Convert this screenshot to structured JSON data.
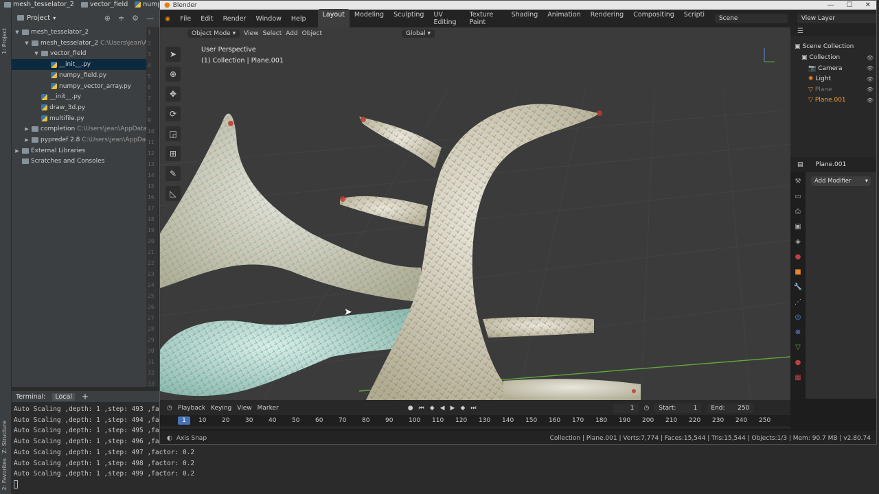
{
  "ide": {
    "tabs": [
      "mesh_tesselator_2",
      "vector_field",
      "nump"
    ],
    "project_label": "Project",
    "side_labels": [
      "1: Project",
      "Z: Structure",
      "2: Favorites"
    ],
    "tree": [
      {
        "label": "mesh_tesselator_2",
        "path": "",
        "indent": 0,
        "arrow": "▼",
        "icon": "folder"
      },
      {
        "label": "mesh_tesselator_2",
        "path": "C:\\Users\\jean\\Ap",
        "indent": 1,
        "arrow": "▼",
        "icon": "folder"
      },
      {
        "label": "vector_field",
        "path": "",
        "indent": 2,
        "arrow": "▼",
        "icon": "folder"
      },
      {
        "label": "__init__.py",
        "path": "",
        "indent": 3,
        "arrow": "",
        "icon": "py",
        "selected": true
      },
      {
        "label": "numpy_field.py",
        "path": "",
        "indent": 3,
        "arrow": "",
        "icon": "py"
      },
      {
        "label": "numpy_vector_array.py",
        "path": "",
        "indent": 3,
        "arrow": "",
        "icon": "py"
      },
      {
        "label": "__init__.py",
        "path": "",
        "indent": 2,
        "arrow": "",
        "icon": "py"
      },
      {
        "label": "draw_3d.py",
        "path": "",
        "indent": 2,
        "arrow": "",
        "icon": "py"
      },
      {
        "label": "multifile.py",
        "path": "",
        "indent": 2,
        "arrow": "",
        "icon": "py"
      },
      {
        "label": "completion",
        "path": "C:\\Users\\jean\\AppData\\",
        "indent": 1,
        "arrow": "▶",
        "icon": "folder"
      },
      {
        "label": "pypredef 2.8",
        "path": "C:\\Users\\jean\\AppData\\",
        "indent": 1,
        "arrow": "▶",
        "icon": "folder"
      },
      {
        "label": "External Libraries",
        "path": "",
        "indent": 0,
        "arrow": "▶",
        "icon": "lib"
      },
      {
        "label": "Scratches and Consoles",
        "path": "",
        "indent": 0,
        "arrow": "",
        "icon": "scratch"
      }
    ],
    "gutter_numbers": [
      "1",
      "2",
      "3",
      "4",
      "5",
      "6",
      "7",
      "8",
      "9",
      "10",
      "11",
      "12",
      "13",
      "14",
      "15",
      "16",
      "17",
      "18",
      "19",
      "20",
      "21",
      "22",
      "23",
      "24",
      "25",
      "26",
      "27",
      "28",
      "29",
      "30",
      "31",
      "32",
      "33"
    ],
    "terminal": {
      "title": "Terminal:",
      "tab": "Local",
      "add": "+",
      "lines": [
        "Auto Scaling ,depth: 1 ,step: 493 ,fac",
        "Auto Scaling ,depth: 1 ,step: 494 ,fac",
        "Auto Scaling ,depth: 1 ,step: 495 ,fac",
        "Auto Scaling ,depth: 1 ,step: 496 ,fac",
        "Auto Scaling ,depth: 1 ,step: 497 ,factor: 0.2",
        "Auto Scaling ,depth: 1 ,step: 498 ,factor: 0.2",
        "Auto Scaling ,depth: 1 ,step: 499 ,factor: 0.2"
      ]
    }
  },
  "blender": {
    "title": "Blender",
    "menus": [
      "File",
      "Edit",
      "Render",
      "Window",
      "Help"
    ],
    "workspaces": [
      "Layout",
      "Modeling",
      "Sculpting",
      "UV Editing",
      "Texture Paint",
      "Shading",
      "Animation",
      "Rendering",
      "Compositing",
      "Scripti"
    ],
    "active_workspace": "Layout",
    "scene": "Scene",
    "view_layer": "View Layer",
    "viewport": {
      "mode": "Object Mode",
      "menus": [
        "View",
        "Select",
        "Add",
        "Object"
      ],
      "orientation": "Global",
      "perspective": "User Perspective",
      "collection_info": "(1) Collection | Plane.001"
    },
    "outliner": {
      "title": "Scene Collection",
      "items": [
        {
          "label": "Collection",
          "indent": 1
        },
        {
          "label": "Camera",
          "indent": 2
        },
        {
          "label": "Light",
          "indent": 2
        },
        {
          "label": "Plane",
          "indent": 2,
          "dim": true
        },
        {
          "label": "Plane.001",
          "indent": 2,
          "active": true
        }
      ]
    },
    "properties": {
      "object": "Plane.001",
      "add_modifier": "Add Modifier"
    },
    "timeline": {
      "menus": [
        "Playback",
        "Keying",
        "View",
        "Marker"
      ],
      "current_frame": "1",
      "start_label": "Start:",
      "start": "1",
      "end_label": "End:",
      "end": "250",
      "ticks": [
        "10",
        "20",
        "30",
        "40",
        "50",
        "60",
        "70",
        "80",
        "90",
        "100",
        "110",
        "120",
        "130",
        "140",
        "150",
        "160",
        "170",
        "180",
        "190",
        "200",
        "210",
        "220",
        "230",
        "240",
        "250"
      ]
    },
    "status": {
      "left": "Axis Snap",
      "right": "Collection | Plane.001 | Verts:7,774 | Faces:15,544 | Tris:15,544 | Objects:1/3 | Mem: 90.7 MB | v2.80.74"
    },
    "colors": {
      "accent": "#4772b3",
      "active_orange": "#f0a040",
      "selection": "#0d293e"
    }
  }
}
